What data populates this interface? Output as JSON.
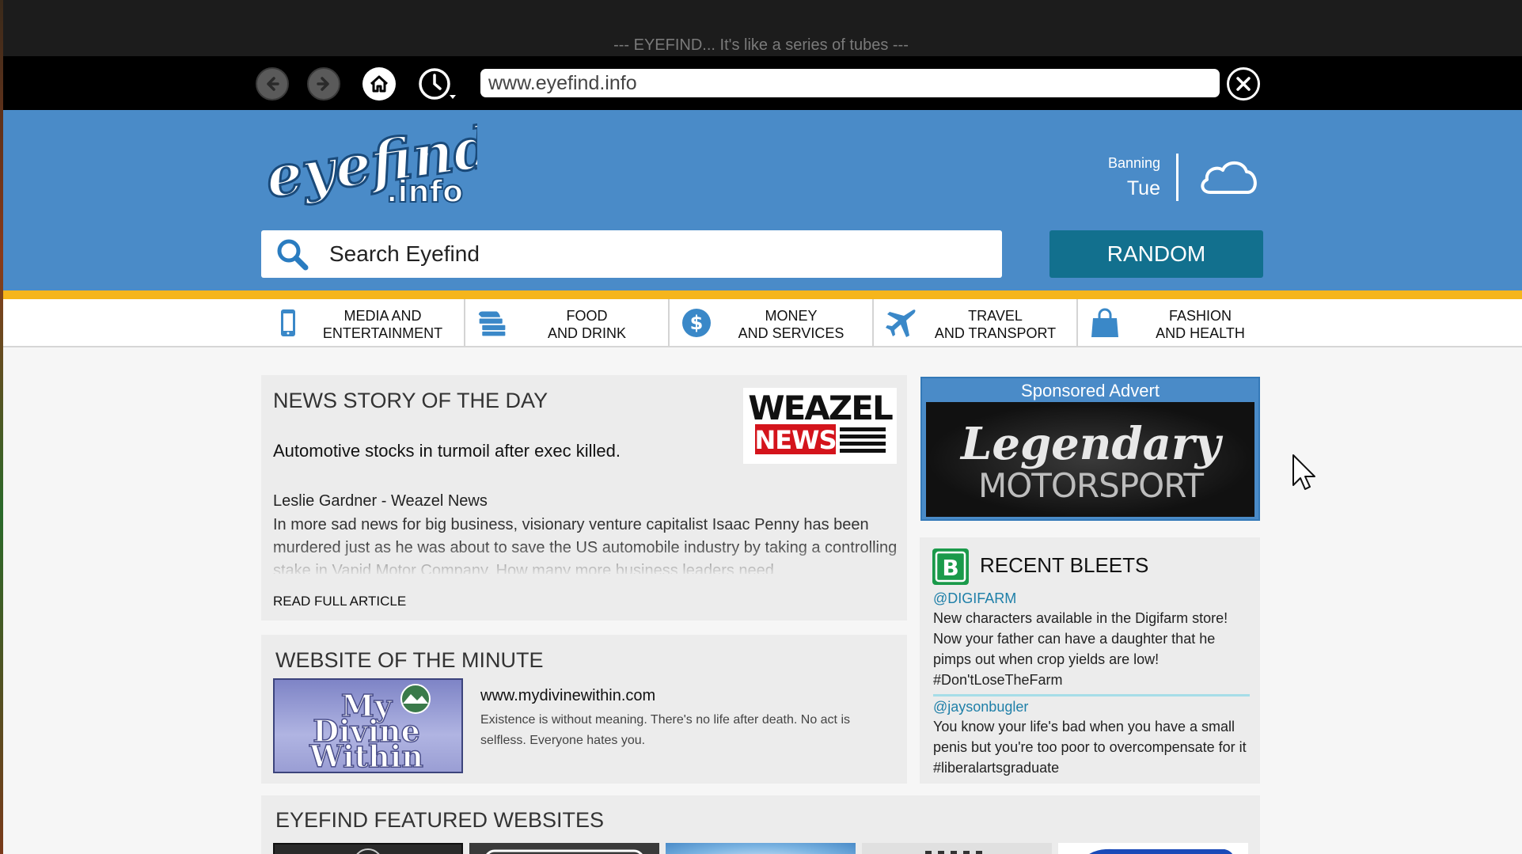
{
  "browser": {
    "tagline": "--- EYEFIND... It's like a series of tubes ---",
    "url": "www.eyefind.info"
  },
  "header": {
    "logo_text_top": "eyefind",
    "logo_text_bottom": ".info",
    "weather": {
      "location": "Banning",
      "day": "Tue",
      "icon": "cloud-icon"
    },
    "search_placeholder": "Search Eyefind",
    "random_label": "RANDOM"
  },
  "categories": [
    {
      "line1": "MEDIA AND",
      "line2": "ENTERTAINMENT",
      "icon": "phone-icon"
    },
    {
      "line1": "FOOD",
      "line2": "AND DRINK",
      "icon": "food-icon"
    },
    {
      "line1": "MONEY",
      "line2": "AND SERVICES",
      "icon": "dollar-icon"
    },
    {
      "line1": "TRAVEL",
      "line2": "AND TRANSPORT",
      "icon": "plane-icon"
    },
    {
      "line1": "FASHION",
      "line2": "AND HEALTH",
      "icon": "shopping-bag-icon"
    }
  ],
  "news": {
    "heading": "NEWS STORY OF THE DAY",
    "headline": "Automotive stocks in turmoil after exec killed.",
    "byline": "Leslie Gardner - Weazel News",
    "body": "In more sad news for big business, visionary venture capitalist Isaac Penny has been murdered just as he was about to save the US automobile industry by taking a controlling stake in Vapid Motor Company. How many more business leaders need",
    "read_more": "READ FULL ARTICLE",
    "logo_top": "WEAZEL",
    "logo_bottom": "NEWS"
  },
  "website_of_minute": {
    "heading": "WEBSITE OF THE MINUTE",
    "image_text": [
      "My",
      "Divine",
      "Within"
    ],
    "url": "www.mydivinewithin.com",
    "description": "Existence is without meaning. There's no life after death. No act is selfless. Everyone hates you."
  },
  "advert": {
    "title": "Sponsored Advert",
    "line1": "Legendary",
    "line2": "MOTORSPORT"
  },
  "bleets": {
    "heading": "RECENT BLEETS",
    "icon_letter": "B",
    "items": [
      {
        "user": "@DIGIFARM",
        "text": "New characters available in the Digifarm store! Now your father can have a daughter that he pimps out when crop yields are low! #Don'tLoseTheFarm"
      },
      {
        "user": "@jaysonbugler",
        "text": "You know your life's bad when you have a small penis but you're too poor to overcompensate for it #liberalartsgraduate"
      }
    ]
  },
  "featured": {
    "heading": "EYEFIND FEATURED WEBSITES"
  }
}
